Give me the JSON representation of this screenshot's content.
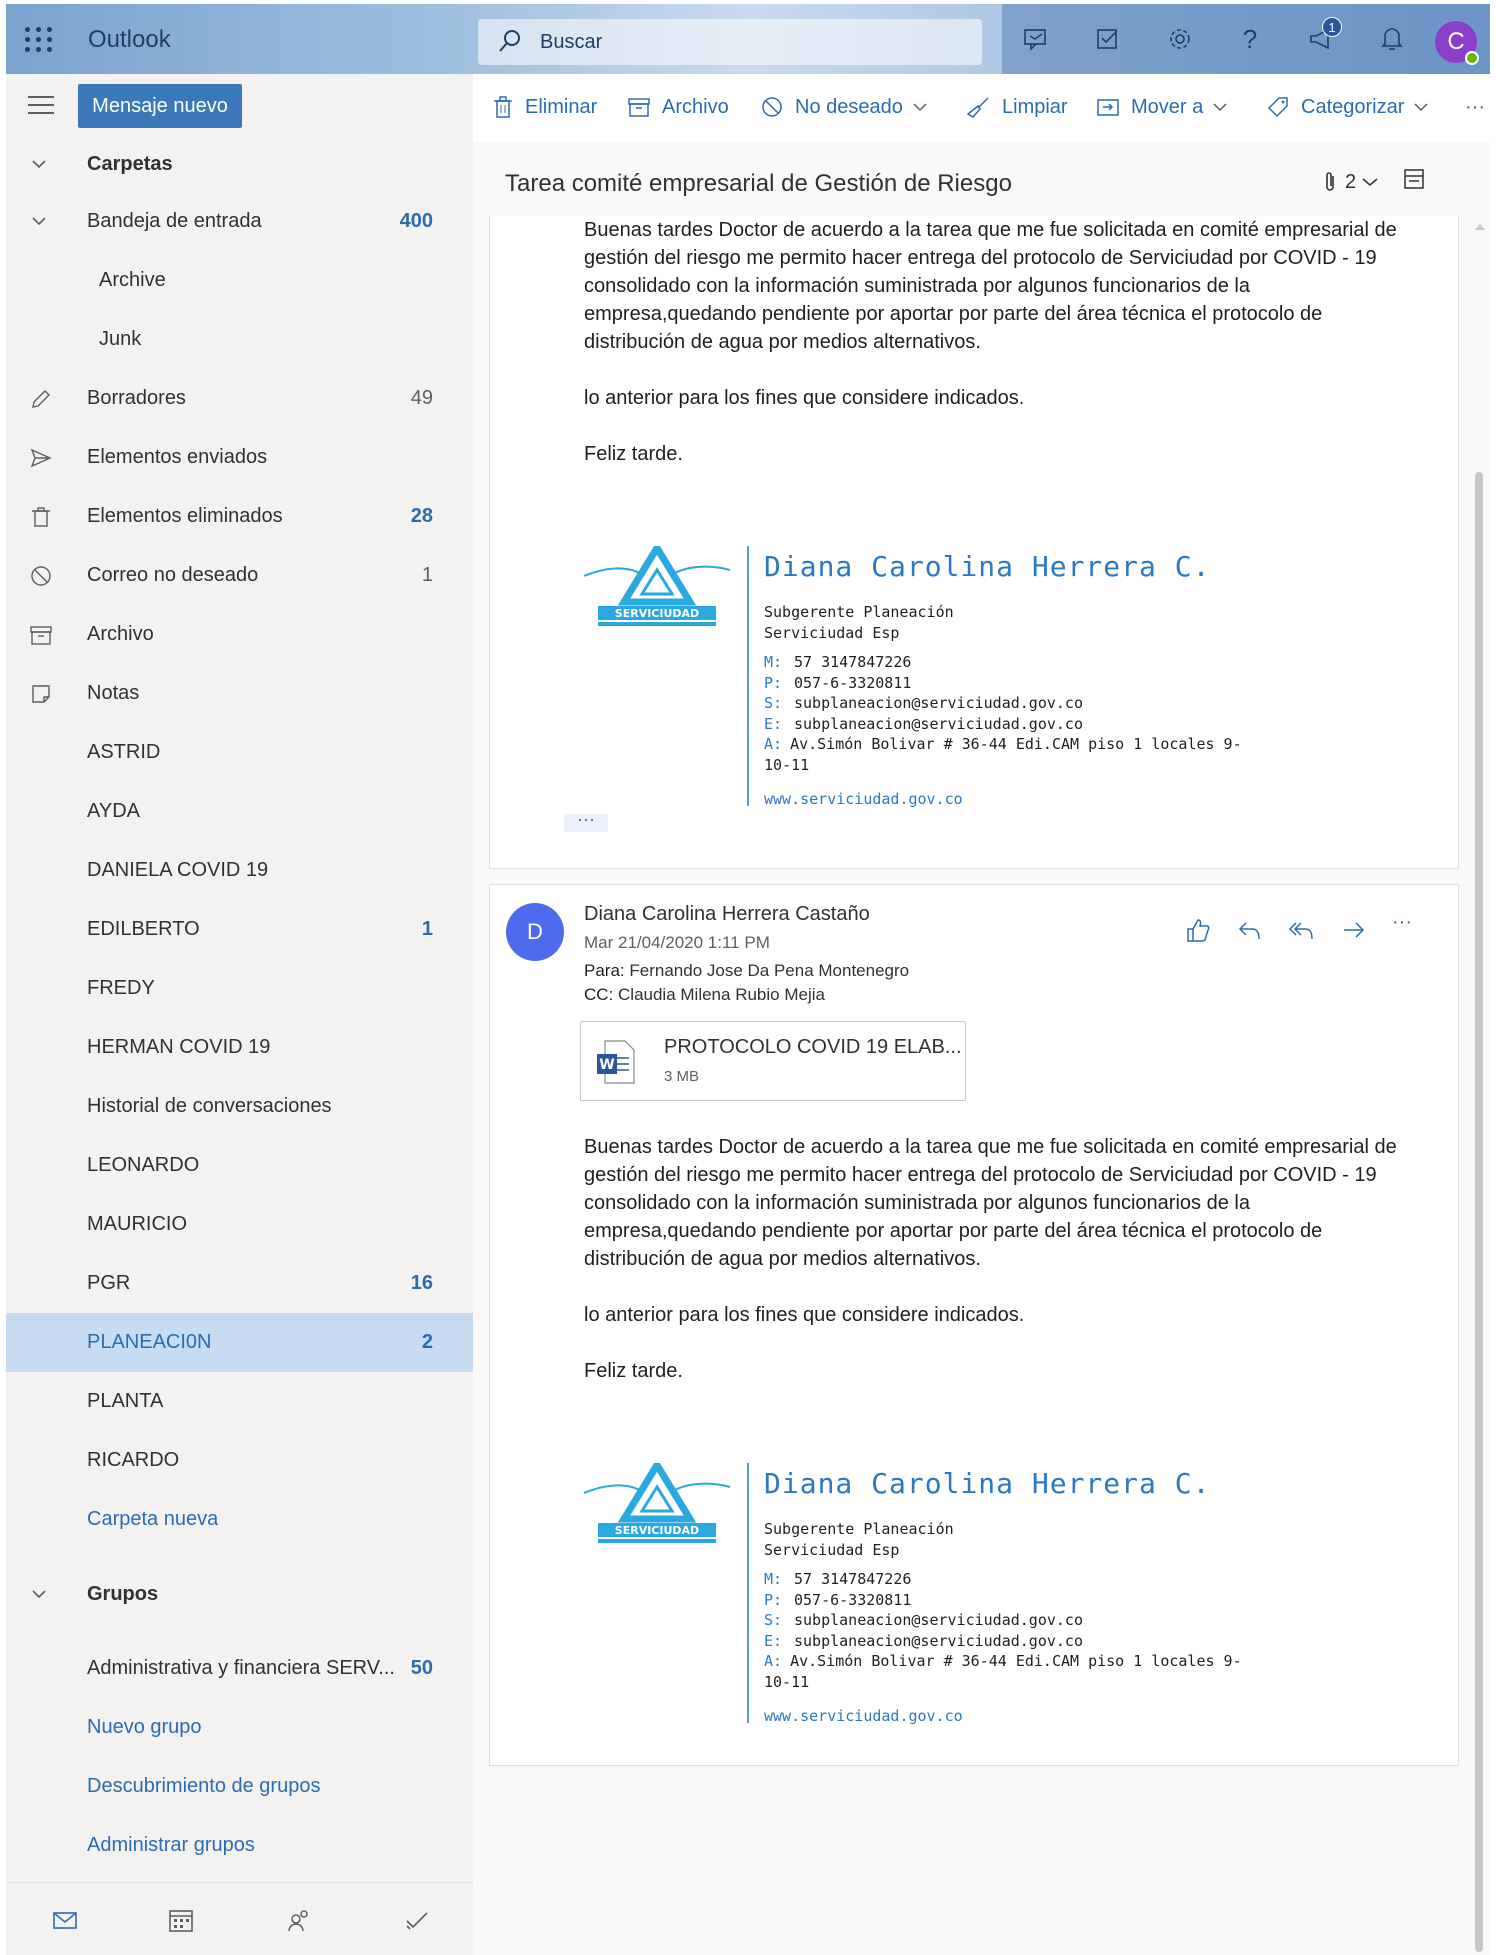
{
  "topbar": {
    "brand": "Outlook",
    "search_placeholder": "Buscar",
    "notifications_badge": "1",
    "avatar_initial": "C"
  },
  "nav": {
    "new_mail": "Mensaje nuevo",
    "folders_header": "Carpetas",
    "folders": [
      {
        "label": "Bandeja de entrada",
        "count": "400"
      },
      {
        "label": "Archive",
        "count": ""
      },
      {
        "label": "Junk",
        "count": ""
      },
      {
        "label": "Borradores",
        "count": "49"
      },
      {
        "label": "Elementos enviados",
        "count": ""
      },
      {
        "label": "Elementos eliminados",
        "count": "28"
      },
      {
        "label": "Correo no deseado",
        "count": "1"
      },
      {
        "label": "Archivo",
        "count": ""
      },
      {
        "label": "Notas",
        "count": ""
      },
      {
        "label": "ASTRID",
        "count": ""
      },
      {
        "label": "AYDA",
        "count": ""
      },
      {
        "label": "DANIELA COVID 19",
        "count": ""
      },
      {
        "label": "EDILBERTO",
        "count": "1"
      },
      {
        "label": "FREDY",
        "count": ""
      },
      {
        "label": "HERMAN COVID 19",
        "count": ""
      },
      {
        "label": "Historial de conversaciones",
        "count": ""
      },
      {
        "label": "LEONARDO",
        "count": ""
      },
      {
        "label": "MAURICIO",
        "count": ""
      },
      {
        "label": "PGR",
        "count": "16"
      },
      {
        "label": "PLANEACI0N",
        "count": "2"
      },
      {
        "label": "PLANTA",
        "count": ""
      },
      {
        "label": "RICARDO",
        "count": ""
      }
    ],
    "new_folder": "Carpeta nueva",
    "groups_header": "Grupos",
    "group_item": {
      "label": "Administrativa y financiera SERV...",
      "count": "50"
    },
    "new_group": "Nuevo grupo",
    "discover_groups": "Descubrimiento de grupos",
    "manage_groups": "Administrar grupos"
  },
  "commands": {
    "delete": "Eliminar",
    "archive": "Archivo",
    "junk": "No deseado",
    "sweep": "Limpiar",
    "move": "Mover a",
    "categorize": "Categorizar",
    "more": "···"
  },
  "thread": {
    "subject": "Tarea comité empresarial de Gestión de Riesgo",
    "attachment_count": "2"
  },
  "message1": {
    "body1": "Buenas tardes Doctor de acuerdo a la tarea que me fue solicitada en comité empresarial de gestión del riesgo me permito hacer entrega del protocolo de Serviciudad por COVID - 19 consolidado con la información suministrada por algunos funcionarios de la empresa,quedando pendiente por aportar por parte del área técnica el protocolo de distribución de agua por medios alternativos.",
    "body2": "lo anterior para los fines que considere indicados.",
    "body3": "Feliz tarde.",
    "expand": "···"
  },
  "message2": {
    "avatar_initial": "D",
    "sender": "Diana Carolina Herrera Castaño",
    "date": "Mar 21/04/2020 1:11 PM",
    "to_label": "Para:",
    "to": "Fernando Jose Da Pena Montenegro",
    "cc_label": "CC:",
    "cc": "Claudia Milena Rubio Mejia",
    "attachment_name": "PROTOCOLO COVID 19 ELAB...",
    "attachment_size": "3 MB",
    "more": "···",
    "body1": "Buenas tardes Doctor de acuerdo a la tarea que me fue solicitada en comité empresarial de gestión del riesgo me permito hacer entrega del protocolo de Serviciudad por COVID - 19 consolidado con la información suministrada por algunos funcionarios de la empresa,quedando pendiente por aportar por parte del área técnica el protocolo de distribución de agua por medios alternativos.",
    "body2": "lo anterior para los fines que considere indicados.",
    "body3": "Feliz tarde."
  },
  "signature": {
    "logo_text": "SERVICIUDAD",
    "name": "Diana Carolina Herrera C.",
    "title": "Subgerente Planeación",
    "company": "Serviciudad Esp",
    "m_key": "M:",
    "m_val": "57 3147847226",
    "p_key": "P:",
    "p_val": "057-6-3320811",
    "s_key": "S:",
    "s_val": "subplaneacion@serviciudad.gov.co",
    "e_key": "E:",
    "e_val": "subplaneacion@serviciudad.gov.co",
    "a_key": "A:",
    "a_val": "Av.Simón Bolivar # 36-44 Edi.CAM piso 1 locales 9-10-11",
    "web": "www.serviciudad.gov.co"
  },
  "colors": {
    "accent": "#2b6cb0",
    "selected_folder_bg": "#c7dcf0",
    "signature_blue": "#2b78c5"
  }
}
